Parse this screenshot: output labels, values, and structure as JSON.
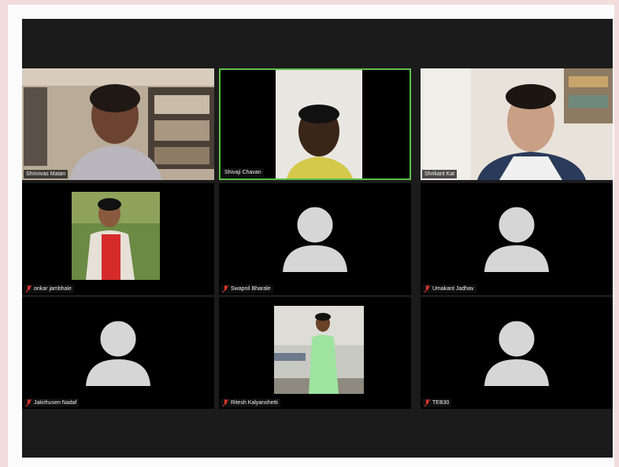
{
  "participants": [
    {
      "name": "Shrinivas Matan",
      "video": true,
      "muted": false
    },
    {
      "name": "Shivaji Chavan",
      "video": true,
      "muted": false,
      "active_speaker": true
    },
    {
      "name": "Shrikant Kat",
      "video": true,
      "muted": false
    },
    {
      "name": "onkar jambhale",
      "video": true,
      "muted": true
    },
    {
      "name": "Swapnil Bharale",
      "video": false,
      "muted": true
    },
    {
      "name": "Umakant Jadhav",
      "video": false,
      "muted": true
    },
    {
      "name": "Jakirhusen Nadaf",
      "video": false,
      "muted": true
    },
    {
      "name": "Ritesh Kalyanshetti",
      "video": true,
      "muted": true
    },
    {
      "name": "TEB30",
      "video": false,
      "muted": true
    }
  ],
  "colors": {
    "active_border": "#5fbf4a",
    "muted_mic": "#e0342a",
    "avatar": "#d6d6d6"
  },
  "icons": {
    "muted": "muted-mic-icon",
    "no_video": "person-avatar-icon"
  }
}
